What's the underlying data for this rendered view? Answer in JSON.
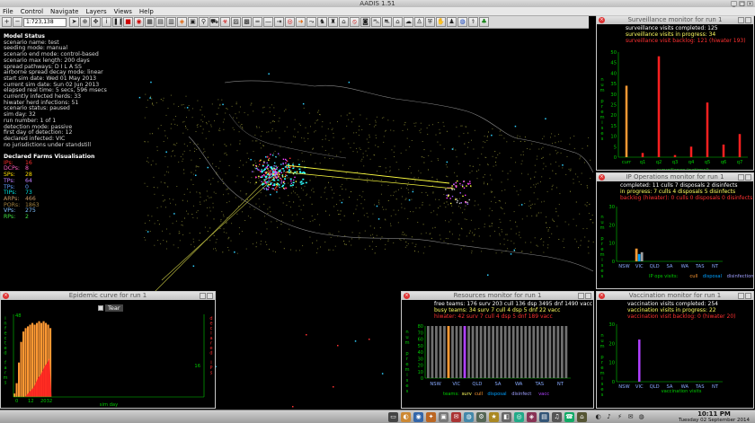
{
  "window": {
    "title": "AADIS 1.51"
  },
  "menu": [
    "File",
    "Control",
    "Navigate",
    "Layers",
    "Views",
    "Help"
  ],
  "toolbar": {
    "scale": "1:723,138"
  },
  "model_status": {
    "heading": "Model Status",
    "lines": [
      "scenario name: test",
      "seeding mode: manual",
      "scenario end mode: control-based",
      "scenario max length: 200 days",
      "spread pathways: D I L A SS",
      "airborne spread decay mode: linear",
      "start sim date: Wed 01 May 2013",
      "current sim date: Sun 02 Jun 2013",
      "elapsed real time: 5 secs, 596 msecs",
      "currently infected herds: 33",
      "hiwater herd infections: 51",
      "scenario status: paused",
      "sim day: 32",
      "run number: 1 of 1",
      "detection mode: passive",
      "first day of detection: 12",
      "declared infected: VIC",
      "no jurisdictions under standstill"
    ]
  },
  "declared": {
    "heading": "Declared Farms Visualisation",
    "items": [
      {
        "label": "IPs:",
        "value": "16",
        "color": "#ff3030"
      },
      {
        "label": "DCPs:",
        "value": "8",
        "color": "#ff60c0"
      },
      {
        "label": "SPs:",
        "value": "28",
        "color": "#ffe000"
      },
      {
        "label": "TPs:",
        "value": "64",
        "color": "#c080ff"
      },
      {
        "label": "TPs:",
        "value": "0",
        "color": "#60a0ff"
      },
      {
        "label": "TIPs:",
        "value": "73",
        "color": "#00e0e0"
      },
      {
        "label": "ARPs:",
        "value": "466",
        "color": "#c09060"
      },
      {
        "label": "PORs:",
        "value": "1863",
        "color": "#a08040"
      },
      {
        "label": "VPs:",
        "value": "275",
        "color": "#80c0ff"
      },
      {
        "label": "RPs:",
        "value": "2",
        "color": "#40e040"
      }
    ]
  },
  "surveillance": {
    "title": "Surveillance monitor for run 1",
    "completed": "surveillance visits completed: 125",
    "in_progress": "surveillance visits in progress: 34",
    "backlog": "surveillance visit backlog: 121  (hiwater 193)",
    "xlabel": "surveillance (national)",
    "ylabel_letters": [
      "n",
      "u",
      "m",
      "",
      "p",
      "r",
      "e",
      "m",
      "i",
      "s",
      "e",
      "s"
    ]
  },
  "ip_ops": {
    "title": "IP Operations monitor for run 1",
    "completed": "completed:  11 culls  7 disposals  2 disinfects",
    "in_progress": "in progress:  7 culls  4 disposals  5 disinfects",
    "backlog": "backlog (hiwater):  0 culls  0 disposals  0 disinfects",
    "legend": [
      "IP ops visits:",
      "cull",
      "disposal",
      "disinfection"
    ]
  },
  "vaccination": {
    "title": "Vaccination monitor for run 1",
    "completed": "vaccination visits completed: 254",
    "in_progress": "vaccination visits in progress: 22",
    "backlog": "vaccination visit backlog: 0  (hiwater 20)",
    "xlabel": "vaccination visits"
  },
  "resources": {
    "title": "Resources monitor for run 1",
    "free": "free teams:  176 surv  203 cull  136 dsp  3495 dnf  1490 vacc",
    "busy": "busy teams:  34 surv  7 cull  4 dsp  5 dnf  22 vacc",
    "hiwater": "hiwater:  42 surv  7 cull  4 dsp  5 dnf  189 vacc",
    "legend": [
      "teams:",
      "surv",
      "cull",
      "disposal",
      "disinfect",
      "vacc"
    ]
  },
  "epidemic": {
    "title": "Epidemic curve for run 1",
    "toggle": "Tear",
    "xlabel": "sim day",
    "xticks": [
      "0",
      "12",
      "2032"
    ],
    "left_label": "infected farms",
    "right_label": "declared IPs",
    "right_tick": "16"
  },
  "taskbar": {
    "time": "10:11 PM",
    "date": "Tuesday 02 September 2014"
  },
  "chart_data": [
    {
      "type": "bar",
      "title": "Surveillance monitor for run 1",
      "xlabel": "surveillance (national)",
      "ylabel": "num premises",
      "categories": [
        "curr",
        "q1",
        "q2",
        "q3",
        "q4",
        "q5",
        "q6",
        "q7"
      ],
      "values": [
        34,
        2,
        48,
        1,
        5,
        26,
        6,
        11
      ],
      "colors": [
        "#ff9933",
        "#ff2020",
        "#ff2020",
        "#ff2020",
        "#ff2020",
        "#ff2020",
        "#ff2020",
        "#ff2020"
      ],
      "yticks": [
        0,
        5,
        10,
        15,
        20,
        25,
        30,
        35,
        40,
        45,
        50
      ],
      "ylim": [
        0,
        50
      ]
    },
    {
      "type": "bar",
      "title": "IP Operations monitor for run 1",
      "xlabel": "",
      "ylabel": "num premises",
      "categories": [
        "NSW",
        "VIC",
        "QLD",
        "SA",
        "WA",
        "TAS",
        "NT"
      ],
      "series": [
        {
          "name": "cull",
          "values": [
            0,
            7,
            0,
            0,
            0,
            0,
            0
          ],
          "color": "#ff9933"
        },
        {
          "name": "disposal",
          "values": [
            0,
            4,
            0,
            0,
            0,
            0,
            0
          ],
          "color": "#00a0ff"
        },
        {
          "name": "disinfection",
          "values": [
            0,
            5,
            0,
            0,
            0,
            0,
            0
          ],
          "color": "#a0a0a0"
        }
      ],
      "yticks": [
        0,
        10,
        20,
        30
      ],
      "ylim": [
        0,
        30
      ]
    },
    {
      "type": "bar",
      "title": "Vaccination monitor for run 1",
      "xlabel": "vaccination visits",
      "ylabel": "num premises",
      "categories": [
        "NSW",
        "VIC",
        "QLD",
        "SA",
        "WA",
        "TAS",
        "NT"
      ],
      "values": [
        0,
        22,
        0,
        0,
        0,
        0,
        0
      ],
      "colors": [
        "#b040ff",
        "#b040ff",
        "#b040ff",
        "#b040ff",
        "#b040ff",
        "#b040ff",
        "#b040ff"
      ],
      "yticks": [
        0,
        10,
        20,
        30
      ],
      "ylim": [
        0,
        30
      ]
    },
    {
      "type": "bar",
      "title": "Resources monitor for run 1",
      "xlabel": "",
      "ylabel": "num premises",
      "categories": [
        "NSW",
        "VIC",
        "QLD",
        "SA",
        "WA",
        "TAS",
        "NT"
      ],
      "groups_per_category": 5,
      "values": [
        80,
        80,
        80,
        80,
        80,
        80,
        80,
        80,
        80,
        80,
        80,
        80,
        80,
        80,
        80,
        80,
        80,
        80,
        80,
        80,
        80,
        80,
        80,
        80,
        80,
        80,
        80,
        80,
        80,
        80,
        80,
        80,
        80,
        80,
        80
      ],
      "highlight": {
        "index": 5,
        "color": "#ff9933"
      },
      "highlight2": {
        "index": 9,
        "color": "#b040ff"
      },
      "yticks": [
        0,
        10,
        20,
        30,
        40,
        50,
        60,
        70,
        80
      ],
      "ylim": [
        0,
        80
      ]
    },
    {
      "type": "area",
      "title": "Epidemic curve for run 1",
      "xlabel": "sim day",
      "ylabel": "infected farms",
      "x": [
        0,
        2,
        4,
        6,
        8,
        10,
        12,
        14,
        16,
        18,
        20,
        22,
        24,
        26,
        28,
        30,
        32
      ],
      "series": [
        {
          "name": "infected farms",
          "values": [
            2,
            8,
            20,
            32,
            38,
            40,
            41,
            42,
            43,
            42,
            43,
            44,
            43,
            44,
            43,
            42,
            40
          ],
          "color": "#ff9933"
        },
        {
          "name": "declared IPs",
          "values": [
            0,
            0,
            0,
            0,
            0,
            0,
            1,
            2,
            3,
            4,
            6,
            8,
            9,
            11,
            13,
            14,
            16
          ],
          "color": "#ff2020"
        }
      ],
      "yticks": [
        0,
        48
      ],
      "ylim": [
        0,
        48
      ],
      "xlim": [
        0,
        32
      ]
    }
  ]
}
